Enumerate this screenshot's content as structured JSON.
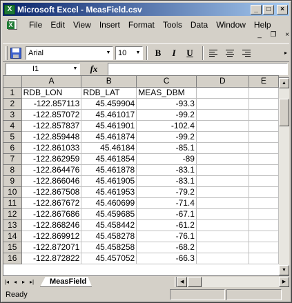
{
  "window": {
    "title": "Microsoft Excel - MeasField.csv",
    "controls": {
      "minimize": "_",
      "maximize": "□",
      "close": "×"
    }
  },
  "menu": {
    "items": [
      "File",
      "Edit",
      "View",
      "Insert",
      "Format",
      "Tools",
      "Data",
      "Window",
      "Help"
    ],
    "doc_controls": {
      "minimize": "_",
      "restore": "❐",
      "close": "×"
    }
  },
  "toolbar": {
    "font_name": "Arial",
    "font_size": "10",
    "bold_label": "B",
    "italic_label": "I",
    "underline_label": "U"
  },
  "formula_bar": {
    "name_box": "I1",
    "fx_label": "fx",
    "formula": ""
  },
  "grid": {
    "column_headers": [
      "A",
      "B",
      "C",
      "D",
      "E"
    ],
    "rows": [
      {
        "row": "1",
        "cells": [
          "RDB_LON",
          "RDB_LAT",
          "MEAS_DBM",
          "",
          ""
        ]
      },
      {
        "row": "2",
        "cells": [
          "-122.857113",
          "45.459904",
          "-93.3",
          "",
          ""
        ]
      },
      {
        "row": "3",
        "cells": [
          "-122.857072",
          "45.461017",
          "-99.2",
          "",
          ""
        ]
      },
      {
        "row": "4",
        "cells": [
          "-122.857837",
          "45.461901",
          "-102.4",
          "",
          ""
        ]
      },
      {
        "row": "5",
        "cells": [
          "-122.859448",
          "45.461874",
          "-99.2",
          "",
          ""
        ]
      },
      {
        "row": "6",
        "cells": [
          "-122.861033",
          "45.46184",
          "-85.1",
          "",
          ""
        ]
      },
      {
        "row": "7",
        "cells": [
          "-122.862959",
          "45.461854",
          "-89",
          "",
          ""
        ]
      },
      {
        "row": "8",
        "cells": [
          "-122.864476",
          "45.461878",
          "-83.1",
          "",
          ""
        ]
      },
      {
        "row": "9",
        "cells": [
          "-122.866046",
          "45.461905",
          "-83.1",
          "",
          ""
        ]
      },
      {
        "row": "10",
        "cells": [
          "-122.867508",
          "45.461953",
          "-79.2",
          "",
          ""
        ]
      },
      {
        "row": "11",
        "cells": [
          "-122.867672",
          "45.460699",
          "-71.4",
          "",
          ""
        ]
      },
      {
        "row": "12",
        "cells": [
          "-122.867686",
          "45.459685",
          "-67.1",
          "",
          ""
        ]
      },
      {
        "row": "13",
        "cells": [
          "-122.868246",
          "45.458442",
          "-61.2",
          "",
          ""
        ]
      },
      {
        "row": "14",
        "cells": [
          "-122.869912",
          "45.458278",
          "-76.1",
          "",
          ""
        ]
      },
      {
        "row": "15",
        "cells": [
          "-122.872071",
          "45.458258",
          "-68.2",
          "",
          ""
        ]
      },
      {
        "row": "16",
        "cells": [
          "-122.872822",
          "45.457052",
          "-66.3",
          "",
          ""
        ]
      }
    ]
  },
  "sheet_tabs": {
    "nav": [
      "|◂",
      "◂",
      "▸",
      "▸|"
    ],
    "active": "MeasField"
  },
  "status": {
    "text": "Ready"
  }
}
